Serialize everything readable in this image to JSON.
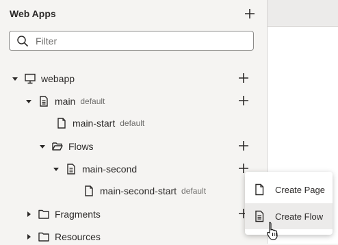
{
  "panel": {
    "title": "Web Apps",
    "add_icon": "plus-icon"
  },
  "filter": {
    "placeholder": "Filter",
    "value": "",
    "icon": "search-icon"
  },
  "tree": {
    "webapp": {
      "label": "webapp",
      "icon": "monitor-icon",
      "expanded": true
    },
    "main": {
      "label": "main",
      "tag": "default",
      "icon": "flow-icon",
      "expanded": true
    },
    "main_start": {
      "label": "main-start",
      "tag": "default",
      "icon": "page-icon"
    },
    "flows": {
      "label": "Flows",
      "icon": "folder-open-icon",
      "expanded": true
    },
    "main_second": {
      "label": "main-second",
      "icon": "flow-icon",
      "expanded": true
    },
    "main_second_start": {
      "label": "main-second-start",
      "tag": "default",
      "icon": "page-icon"
    },
    "fragments": {
      "label": "Fragments",
      "icon": "folder-icon",
      "expanded": false
    },
    "resources": {
      "label": "Resources",
      "icon": "folder-icon",
      "expanded": false
    }
  },
  "context_menu": {
    "items": [
      {
        "label": "Create Page",
        "icon": "page-icon"
      },
      {
        "label": "Create Flow",
        "icon": "flow-icon",
        "hovered": true
      }
    ]
  },
  "colors": {
    "panel_bg": "#f5f4f2",
    "text": "#2c2a29",
    "muted": "#6f6e6c",
    "hover_bg": "#ecebea"
  }
}
